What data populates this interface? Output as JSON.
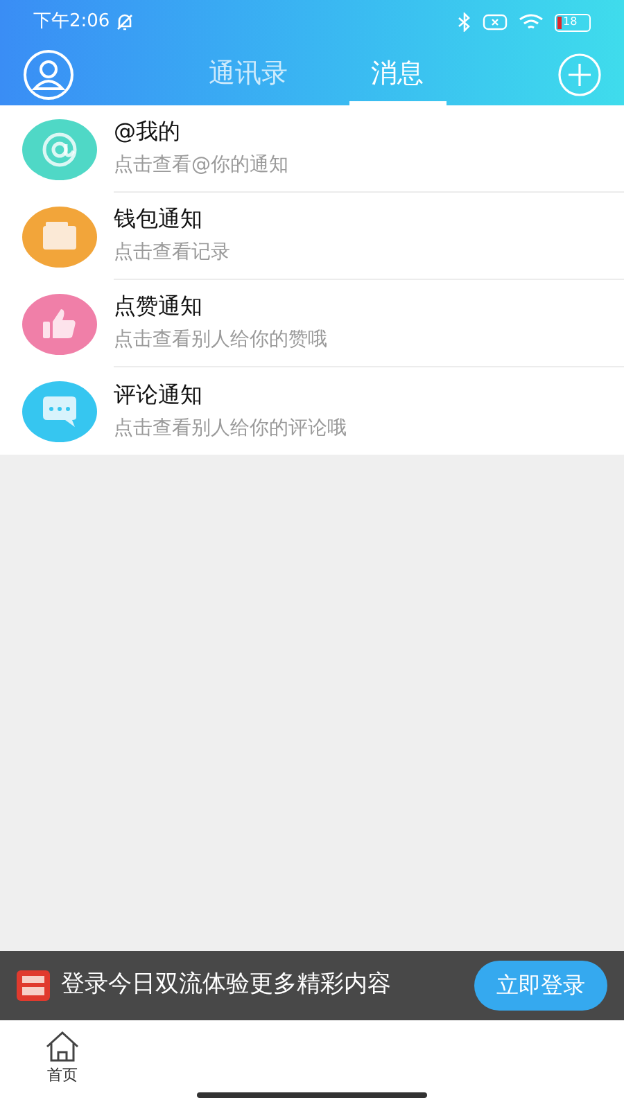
{
  "status_bar": {
    "time": "下午2:06",
    "battery": "18"
  },
  "tabs": [
    {
      "label": "通讯录",
      "selected": false
    },
    {
      "label": "消息",
      "selected": true
    }
  ],
  "notifications": [
    {
      "kind": "at",
      "color": "#4fd8c6",
      "title": "@我的",
      "subtitle": "点击查看@你的通知"
    },
    {
      "kind": "wallet",
      "color": "#f2a53a",
      "title": "钱包通知",
      "subtitle": "点击查看记录"
    },
    {
      "kind": "like",
      "color": "#f07fa8",
      "title": "点赞通知",
      "subtitle": "点击查看别人给你的赞哦"
    },
    {
      "kind": "comment",
      "color": "#36c6f0",
      "title": "评论通知",
      "subtitle": "点击查看别人给你的评论哦"
    }
  ],
  "login_banner": {
    "text": "登录今日双流体验更多精彩内容",
    "button": "立即登录"
  },
  "bottom_nav": [
    {
      "label": "首页"
    }
  ]
}
